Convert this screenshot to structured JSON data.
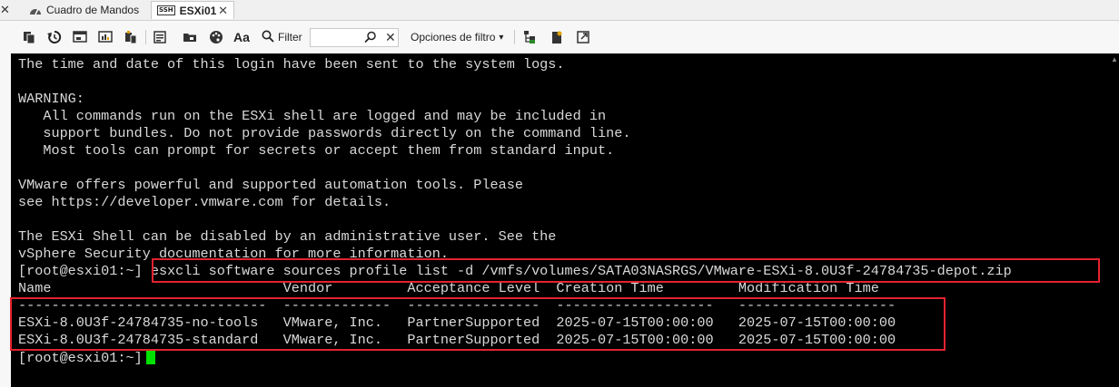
{
  "tabs": [
    {
      "label": "Cuadro de Mandos",
      "icon": "dashboard-icon"
    },
    {
      "label": "ESXi01",
      "icon": "ssh-icon",
      "ssh_text": "SSH",
      "active": true
    }
  ],
  "toolbar": {
    "filter_label": "Filter",
    "filter_value": "",
    "filter_options_label": "Opciones de filtro"
  },
  "terminal": {
    "lines": [
      "The time and date of this login have been sent to the system logs.",
      "",
      "WARNING:",
      "   All commands run on the ESXi shell are logged and may be included in",
      "   support bundles. Do not provide passwords directly on the command line.",
      "   Most tools can prompt for secrets or accept them from standard input.",
      "",
      "VMware offers powerful and supported automation tools. Please",
      "see https://developer.vmware.com for details.",
      "",
      "The ESXi Shell can be disabled by an administrative user. See the",
      "vSphere Security documentation for more information.",
      "[root@esxi01:~] esxcli software sources profile list -d /vmfs/volumes/SATA03NASRGS/VMware-ESXi-8.0U3f-24784735-depot.zip",
      "Name                            Vendor         Acceptance Level  Creation Time         Modification Time",
      "------------------------------  -------------  ----------------  -------------------   -------------------",
      "ESXi-8.0U3f-24784735-no-tools   VMware, Inc.   PartnerSupported  2025-07-15T00:00:00   2025-07-15T00:00:00",
      "ESXi-8.0U3f-24784735-standard   VMware, Inc.   PartnerSupported  2025-07-15T00:00:00   2025-07-15T00:00:00"
    ],
    "prompt": "[root@esxi01:~]"
  },
  "colors": {
    "terminal_bg": "#000000",
    "terminal_fg": "#d9d9d9",
    "cursor": "#00e000",
    "highlight": "#e3232f"
  }
}
